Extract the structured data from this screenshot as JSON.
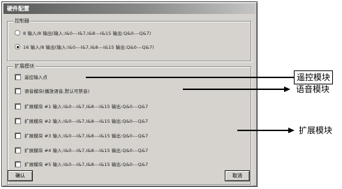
{
  "dialog": {
    "title": "硬件配置",
    "controller_group": {
      "legend": "控制器",
      "options": [
        {
          "label": "8 输入/8 输出(输入:I&0---I&7,I&8---I&15 输出:Q&0---Q&7)",
          "selected": false
        },
        {
          "label": "16 输入/8 输出(输入:I&0---I&7,I&8---I&15 输出:Q&0---Q&7)",
          "selected": true
        }
      ]
    },
    "expansion_group": {
      "legend": "扩展模块",
      "items": [
        {
          "label": "遥控输入点",
          "checked": false
        },
        {
          "label": "语音模块(播放语音,默认可禁音)",
          "checked": false
        },
        {
          "label": "扩展模块 #1 输入:I&0---I&7,I&8---I&15 输出:Q&0---Q&7",
          "checked": false
        },
        {
          "label": "扩展模块 #2 输入:I&0---I&7,I&8---I&15 输出:Q&0---Q&7",
          "checked": false
        },
        {
          "label": "扩展模块 #3 输入:I&0---I&7,I&8---I&15 输出:Q&0---Q&7",
          "checked": false
        },
        {
          "label": "扩展模块 #4 输入:I&0---I&7,I&8---I&15 输出:Q&0---Q&7",
          "checked": false
        },
        {
          "label": "扩展模块 #5 输入:I&0---I&7,I&8---I&15 输出:Q&0---Q&7",
          "checked": false
        }
      ]
    },
    "ok_label": "确认",
    "cancel_label": "取消"
  },
  "annotations": {
    "remote": "遥控模块",
    "voice": "语音模块",
    "expansion": "扩展模块"
  }
}
